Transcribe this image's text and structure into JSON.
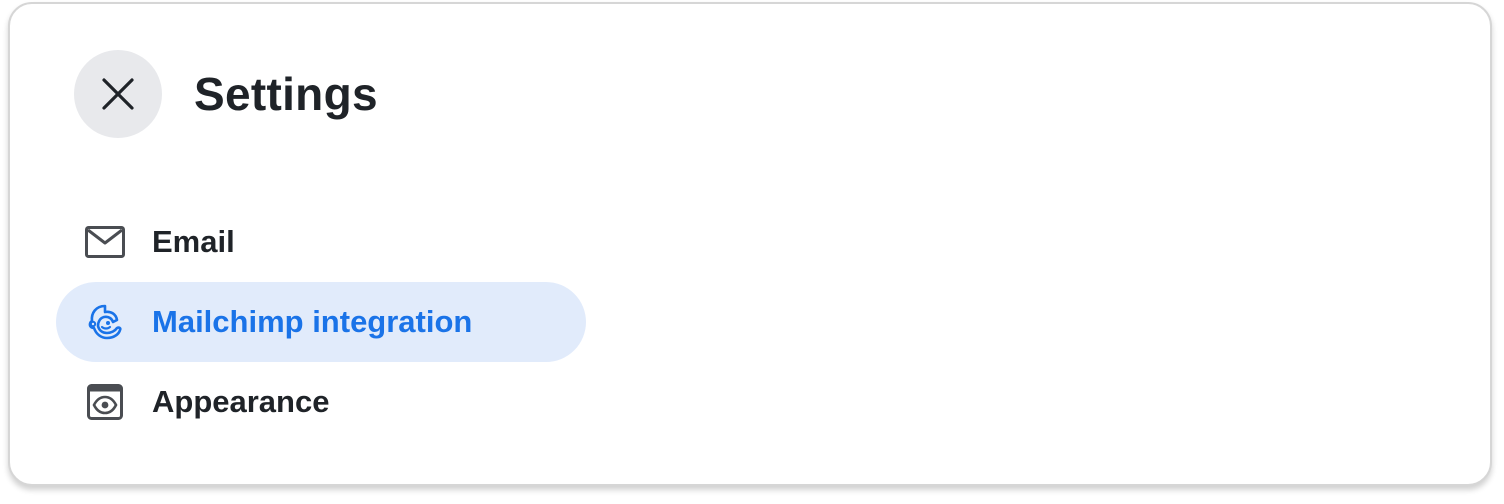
{
  "header": {
    "title": "Settings",
    "close_icon": "close-icon"
  },
  "menu": {
    "items": [
      {
        "label": "Email",
        "icon": "mail-icon",
        "active": false
      },
      {
        "label": "Mailchimp integration",
        "icon": "mailchimp-icon",
        "active": true
      },
      {
        "label": "Appearance",
        "icon": "appearance-icon",
        "active": false
      }
    ]
  },
  "colors": {
    "accent": "#1a73e8",
    "active_bg": "#e1ebfb",
    "text": "#1f2328",
    "icon": "#4a4d52",
    "close_bg": "#e8e9ec"
  }
}
